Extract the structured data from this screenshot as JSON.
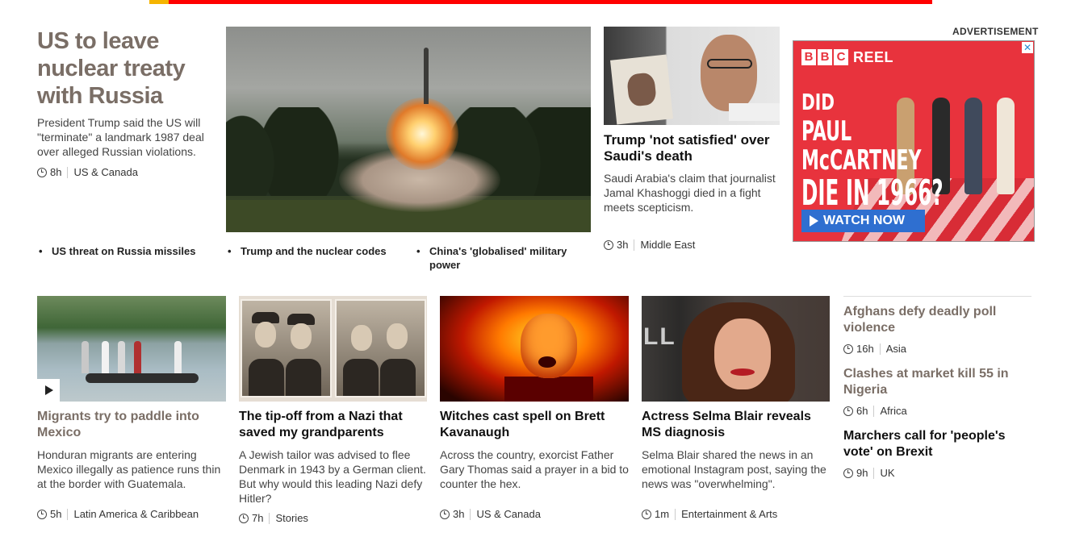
{
  "lead": {
    "title": "US to leave nuclear treaty with Russia",
    "summary": "President Trump said the US will \"terminate\" a landmark 1987 deal over alleged Russian violations.",
    "time": "8h",
    "section": "US & Canada",
    "related": [
      "US threat on Russia missiles",
      "Trump and the nuclear codes",
      "China's 'globalised' military power"
    ]
  },
  "secondary": {
    "title": "Trump 'not satisfied' over Saudi's death",
    "summary": "Saudi Arabia's claim that journalist Jamal Khashoggi died in a fight meets scepticism.",
    "time": "3h",
    "section": "Middle East"
  },
  "ad": {
    "label": "ADVERTISEMENT",
    "brand": [
      "B",
      "B",
      "C"
    ],
    "brand_suffix": "REEL",
    "line1": "DID",
    "line2": "PAUL McCARTNEY",
    "line3": "DIE IN 1966?",
    "cta": "WATCH NOW",
    "close": "✕",
    "color": "#e8333d"
  },
  "cards": [
    {
      "title": "Migrants try to paddle into Mexico",
      "summary": "Honduran migrants are entering Mexico illegally as patience runs thin at the border with Guatemala.",
      "time": "5h",
      "section": "Latin America & Caribbean",
      "has_video": true
    },
    {
      "title": "The tip-off from a Nazi that saved my grandparents",
      "summary": "A Jewish tailor was advised to flee Denmark in 1943 by a German client. But why would this leading Nazi defy Hitler?",
      "time": "7h",
      "section": "Stories"
    },
    {
      "title": "Witches cast spell on Brett Kavanaugh",
      "summary": "Across the country, exorcist Father Gary Thomas said a prayer in a bid to counter the hex.",
      "time": "3h",
      "section": "US & Canada"
    },
    {
      "title": "Actress Selma Blair reveals MS diagnosis",
      "summary": "Selma Blair shared the news in an emotional Instagram post, saying the news was \"overwhelming\".",
      "time": "1m",
      "section": "Entertainment & Arts",
      "sign_text": "LL"
    }
  ],
  "right_list": [
    {
      "title": "Afghans defy deadly poll violence",
      "time": "16h",
      "section": "Asia"
    },
    {
      "title": "Clashes at market kill 55 in Nigeria",
      "time": "6h",
      "section": "Africa"
    },
    {
      "title": "Marchers call for 'people's vote' on Brexit",
      "time": "9h",
      "section": "UK"
    }
  ]
}
